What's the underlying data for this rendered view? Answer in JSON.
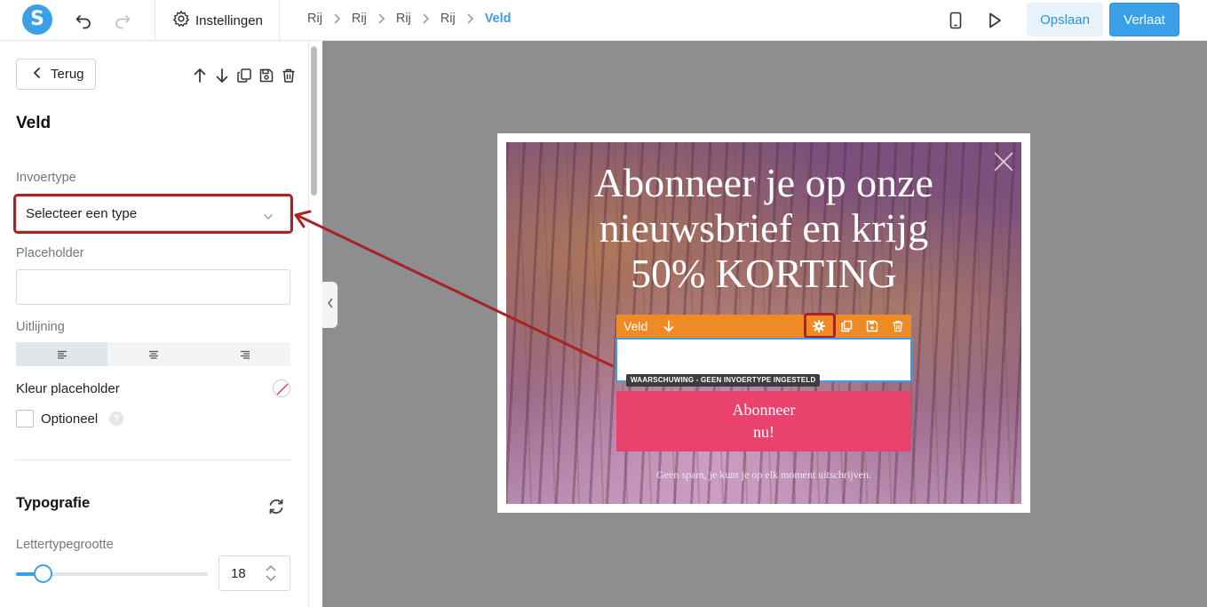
{
  "topbar": {
    "logo_letter": "S",
    "settings_label": "Instellingen",
    "breadcrumbs": [
      "Rij",
      "Rij",
      "Rij",
      "Rij",
      "Veld"
    ],
    "save_label": "Opslaan",
    "leave_label": "Verlaat"
  },
  "panel": {
    "back_label": "Terug",
    "title": "Veld",
    "input_type_label": "Invoertype",
    "input_type_value": "Selecteer een type",
    "placeholder_label": "Placeholder",
    "placeholder_value": "",
    "alignment_label": "Uitlijning",
    "placeholder_color_label": "Kleur placeholder",
    "optional_label": "Optioneel",
    "optional_help": "?",
    "typography_title": "Typografie",
    "font_size_label": "Lettertypegrootte",
    "font_size_value": "18",
    "font_size_slider_fraction": 0.14
  },
  "popup": {
    "headline_line1": "Abonneer je op onze",
    "headline_line2": "nieuwsbrief en krijg",
    "headline_line3": "50% KORTING",
    "field_toolbar_label": "Veld",
    "warning": "WAARSCHUWING - GEEN INVOERTYPE INGESTELD",
    "button_line1": "Abonneer",
    "button_line2": "nu!",
    "fineprint": "Geen spam, je kunt je op elk moment uitschrijven."
  },
  "colors": {
    "accent": "#3aa0e8",
    "highlight": "#a92323",
    "toolbar": "#f08a24",
    "subscribe_button": "#e8426d",
    "canvas": "#8e8e90"
  },
  "icons": [
    "undo-icon",
    "redo-icon",
    "gear-icon",
    "mobile-icon",
    "play-icon",
    "chevron-left-icon",
    "arrow-up-icon",
    "arrow-down-icon",
    "copy-icon",
    "save-icon",
    "trash-icon",
    "chevron-down-icon",
    "align-left-icon",
    "align-center-icon",
    "align-right-icon",
    "no-color-icon",
    "reset-icon",
    "close-icon"
  ]
}
